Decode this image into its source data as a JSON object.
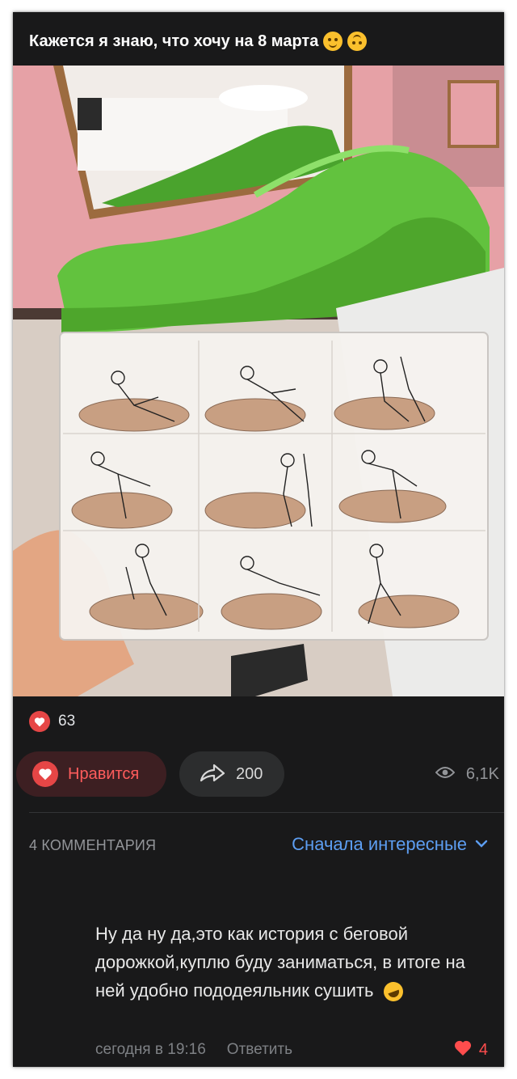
{
  "post": {
    "title": "Кажется я знаю, что хочу на 8 марта",
    "emojis": [
      "smirk-emoji",
      "upside-down-emoji"
    ],
    "image_description_icon": "photo"
  },
  "reactions": {
    "likes_count": "63",
    "like_button_label": "Нравится",
    "share_count": "200",
    "views_count": "6,1K"
  },
  "comments": {
    "count_label": "4 КОММЕНТАРИЯ",
    "sort_label": "Сначала интересные",
    "items": [
      {
        "text": "Ну да ну да,это как история с беговой дорожкой,куплю буду заниматься, в итоге на ней удобно пододеяльник сушить",
        "time": "сегодня в 19:16",
        "reply_label": "Ответить",
        "likes": "4"
      }
    ]
  },
  "colors": {
    "background": "#19191a",
    "accent_red": "#e64646",
    "link_blue": "#5d9ef2",
    "muted": "#939599",
    "sofa_green": "#5cb53a",
    "wall_pink": "#e8a3a8"
  }
}
